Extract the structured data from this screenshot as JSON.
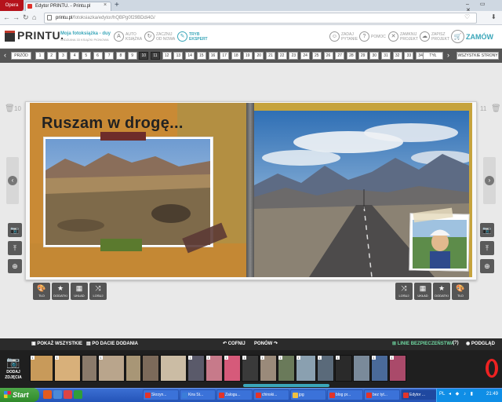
{
  "browser": {
    "menu_label": "Opera",
    "tab_title": "Edytor PRINTU. - Printu.pl",
    "tab_close": "×",
    "new_tab": "+",
    "window_controls": "– ▭ ✕",
    "url_domain": "printu.pl",
    "url_path": "/fotoksiazka/edytor/hQBPg0f29BDdi4G/",
    "nav": {
      "back": "←",
      "forward": "→",
      "reload": "↻",
      "home": "⌂"
    },
    "heart": "♡",
    "download": "⬇"
  },
  "header": {
    "logo": "PRINTU.",
    "project_title": "Moja fotoksiążka - duy",
    "project_subtitle": "WIDZIANA 33 KSIĄŻKI PIONOWA",
    "modes": [
      {
        "icon": "A",
        "label1": "AUTO",
        "label2": "KSIĄŻKA",
        "active": false
      },
      {
        "icon": "↻",
        "label1": "ZACZNIJ",
        "label2": "OD NOWA",
        "active": false
      },
      {
        "icon": "✎",
        "label1": "TRYB",
        "label2": "EKSPERT",
        "active": true
      }
    ],
    "actions": [
      {
        "icon": "☺",
        "label1": "ZADAJ",
        "label2": "PYTANIE"
      },
      {
        "icon": "?",
        "label1": "POMOC",
        "label2": ""
      },
      {
        "icon": "✕",
        "label1": "ZAMKNIJ",
        "label2": "PROJEKT"
      },
      {
        "icon": "☁",
        "label1": "ZAPISZ",
        "label2": "PROJEKT"
      }
    ],
    "order": "ZAMÓW",
    "order_icon": "🛒"
  },
  "page_nav": {
    "prev": "PRZÓD",
    "next": "TYŁ",
    "all_pages": "WSZYSTKIE STRONY",
    "pages": [
      "1",
      "2",
      "3",
      "4",
      "5",
      "6",
      "7",
      "8",
      "9",
      "10",
      "11",
      "12",
      "13",
      "14",
      "15",
      "16",
      "17",
      "18",
      "19",
      "20",
      "21",
      "22",
      "23",
      "24",
      "25",
      "26",
      "27",
      "28",
      "29",
      "30",
      "31",
      "32",
      "33",
      "34"
    ],
    "current": [
      "10",
      "11"
    ]
  },
  "canvas": {
    "left_page_number": "10",
    "right_page_number": "11",
    "headline": "Ruszam w drogę...",
    "left_tools": [
      {
        "icon": "📷",
        "name": "camera-icon"
      },
      {
        "icon": "⤒",
        "name": "text-icon"
      },
      {
        "icon": "⊕",
        "name": "add-icon"
      }
    ],
    "bottom_tools_left": [
      {
        "icon": "🎨",
        "label": "TŁO"
      },
      {
        "icon": "★",
        "label": "DODATKI"
      },
      {
        "icon": "▦",
        "label": "UKŁAD"
      },
      {
        "icon": "⤨",
        "label": "LOSUJ"
      }
    ],
    "bottom_tools_right": [
      {
        "icon": "⤨",
        "label": "LOSUJ"
      },
      {
        "icon": "▦",
        "label": "UKŁAD"
      },
      {
        "icon": "★",
        "label": "DODATKI"
      },
      {
        "icon": "🎨",
        "label": "TŁO"
      }
    ],
    "colors": {
      "left_bg": "#c98a35",
      "right_bg": "#c6a33c",
      "tape_red": "#6e2c2a",
      "tape_green": "#5b7a2e"
    }
  },
  "bottom_bar": {
    "show_all": "POKAŻ WSZYSTKIE",
    "sort": "PO DACIE DODANIA",
    "undo": "COFNIJ",
    "redo": "PONÓW",
    "safety_lines": "LINIE BEZPIECZEŃSTWA",
    "help": "(?)",
    "preview": "PODGLĄD"
  },
  "filmstrip": {
    "add_photos_line1": "DODAJ",
    "add_photos_line2": "ZDJĘCIA",
    "thumbnails": [
      {
        "color": "#c89a5a",
        "badge": "1"
      },
      {
        "color": "#d8b07a",
        "badge": "1"
      },
      {
        "color": "#8a7a6a",
        "badge": ""
      },
      {
        "color": "#b9a58c",
        "badge": "1"
      },
      {
        "color": "#a89676",
        "badge": ""
      },
      {
        "color": "#7c6a5a",
        "badge": ""
      },
      {
        "color": "#cbbca4",
        "badge": ""
      },
      {
        "color": "#5a5a6a",
        "badge": "1"
      },
      {
        "color": "#c77a8a",
        "badge": "1"
      },
      {
        "color": "#d65a7a",
        "badge": "1"
      },
      {
        "color": "#3a3a3a",
        "badge": "1"
      },
      {
        "color": "#9a8a7a",
        "badge": "1"
      },
      {
        "color": "#6a7a5a",
        "badge": "1"
      },
      {
        "color": "#8aa0b0",
        "badge": "1"
      },
      {
        "color": "#5a6a7a",
        "badge": "1"
      },
      {
        "color": "#2a2a2a",
        "badge": "1"
      },
      {
        "color": "#7a8a9a",
        "badge": ""
      },
      {
        "color": "#4a6a9a",
        "badge": "1"
      },
      {
        "color": "#aa4a6a",
        "badge": "1"
      }
    ]
  },
  "taskbar": {
    "start": "Start",
    "buttons": [
      {
        "label": "Skrzyn...",
        "color": "#e2342a",
        "active": false
      },
      {
        "label": "Kira St...",
        "color": "#3b7dd8",
        "active": false
      },
      {
        "label": "Zalogu...",
        "color": "#e2342a",
        "active": false
      },
      {
        "label": "chinski...",
        "color": "#e2342a",
        "active": false
      },
      {
        "label": "jpg",
        "color": "#f0c040",
        "active": false
      },
      {
        "label": "blog pr...",
        "color": "#e2342a",
        "active": false
      },
      {
        "label": "bez tyt...",
        "color": "#e2342a",
        "active": false
      },
      {
        "label": "Edytor ...",
        "color": "#e2342a",
        "active": true
      }
    ],
    "lang": "PL",
    "clock": "21:49"
  }
}
